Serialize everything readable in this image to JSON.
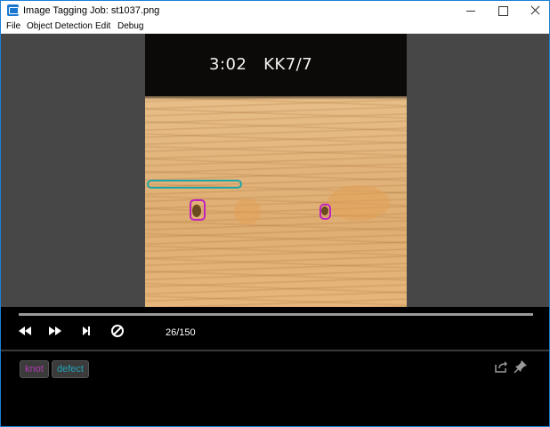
{
  "window": {
    "title": "Image Tagging Job: st1037.png"
  },
  "menu": {
    "items": [
      "File",
      "Object Detection",
      "Edit",
      "Debug"
    ]
  },
  "image": {
    "overlay_text": "3:02   KK7/7",
    "annotations": [
      {
        "label": "defect",
        "color": "#1ea5a5"
      },
      {
        "label": "knot",
        "color": "#c020c0"
      },
      {
        "label": "knot",
        "color": "#c020c0"
      }
    ]
  },
  "playback": {
    "counter": "26/150",
    "progress_percent": 100,
    "icons": [
      "rewind-icon",
      "fast-forward-icon",
      "skip-next-icon",
      "block-icon"
    ]
  },
  "tags": [
    {
      "label": "knot",
      "color": "#b23ab2"
    },
    {
      "label": "defect",
      "color": "#21a3b8"
    }
  ],
  "tag_actions": [
    "export-icon",
    "pin-icon"
  ]
}
